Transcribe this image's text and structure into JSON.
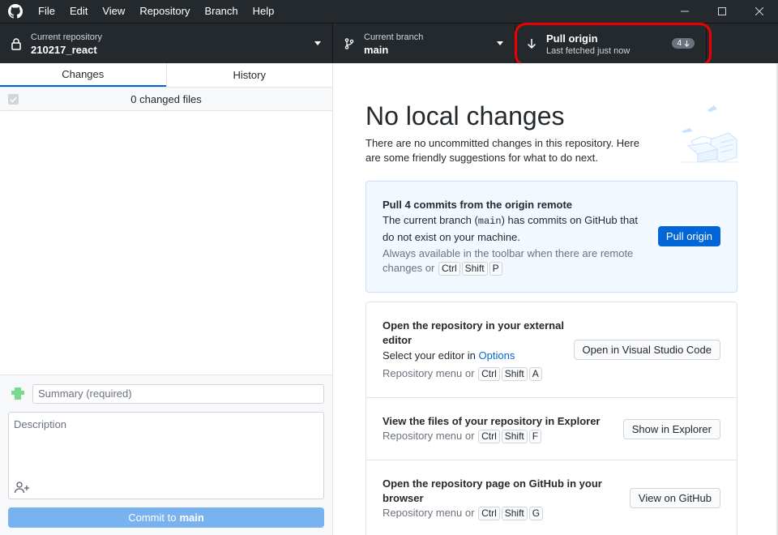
{
  "menu": {
    "items": [
      "File",
      "Edit",
      "View",
      "Repository",
      "Branch",
      "Help"
    ]
  },
  "toolbar": {
    "repo": {
      "label": "Current repository",
      "value": "210217_react"
    },
    "branch": {
      "label": "Current branch",
      "value": "main"
    },
    "pull": {
      "label": "Pull origin",
      "sub": "Last fetched just now",
      "badge": "4"
    }
  },
  "left": {
    "tabs": [
      "Changes",
      "History"
    ],
    "changes_count": "0 changed files",
    "summary_placeholder": "Summary (required)",
    "description_placeholder": "Description",
    "commit_prefix": "Commit to",
    "commit_branch": "main"
  },
  "right": {
    "title": "No local changes",
    "subtitle": "There are no uncommitted changes in this repository. Here are some friendly suggestions for what to do next.",
    "pull_card": {
      "heading": "Pull 4 commits from the origin remote",
      "body_pre": "The current branch (",
      "body_code": "main",
      "body_post": ") has commits on GitHub that do not exist on your machine.",
      "hint": "Always available in the toolbar when there are remote changes or",
      "keys": [
        "Ctrl",
        "Shift",
        "P"
      ],
      "button": "Pull origin"
    },
    "editor_card": {
      "heading": "Open the repository in your external editor",
      "body_pre": "Select your editor in",
      "link": "Options",
      "hint": "Repository menu or",
      "keys": [
        "Ctrl",
        "Shift",
        "A"
      ],
      "button": "Open in Visual Studio Code"
    },
    "explorer_card": {
      "heading": "View the files of your repository in Explorer",
      "hint": "Repository menu or",
      "keys": [
        "Ctrl",
        "Shift",
        "F"
      ],
      "button": "Show in Explorer"
    },
    "github_card": {
      "heading": "Open the repository page on GitHub in your browser",
      "hint": "Repository menu or",
      "keys": [
        "Ctrl",
        "Shift",
        "G"
      ],
      "button": "View on GitHub"
    }
  }
}
